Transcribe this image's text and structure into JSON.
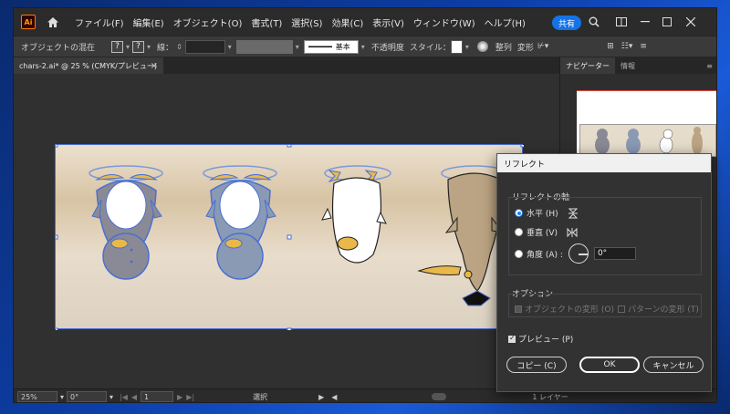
{
  "app": {
    "logo": "Ai"
  },
  "menu": [
    "ファイル(F)",
    "編集(E)",
    "オブジェクト(O)",
    "書式(T)",
    "選択(S)",
    "効果(C)",
    "表示(V)",
    "ウィンドウ(W)",
    "ヘルプ(H)"
  ],
  "share_label": "共有",
  "control": {
    "selection_mode": "オブジェクトの混在",
    "q1": "?",
    "q2": "?",
    "stroke_label": "線：",
    "brush_label": "基本",
    "opacity_label": "不透明度",
    "style_label": "スタイル：",
    "align_label": "整列",
    "transform_label": "変形"
  },
  "document_tab": "chars-2.ai* @ 25 % (CMYK/プレビュー)",
  "panel_tabs": [
    "ナビゲーター",
    "情報"
  ],
  "status": {
    "zoom": "25%",
    "rotation": "0°",
    "artboard_num": "1",
    "tool": "選択",
    "layer": "1 レイヤー"
  },
  "dialog": {
    "title": "リフレクト",
    "axis_group": "リフレクトの軸",
    "horizontal": "水平 (H)",
    "vertical": "垂直 (V)",
    "angle": "角度 (A) :",
    "angle_value": "0°",
    "options_group": "オプション",
    "transform_objects": "オブジェクトの変形 (O)",
    "transform_patterns": "パターンの変形 (T)",
    "preview": "プレビュー (P)",
    "copy": "コピー (C)",
    "ok": "OK",
    "cancel": "キャンセル"
  }
}
